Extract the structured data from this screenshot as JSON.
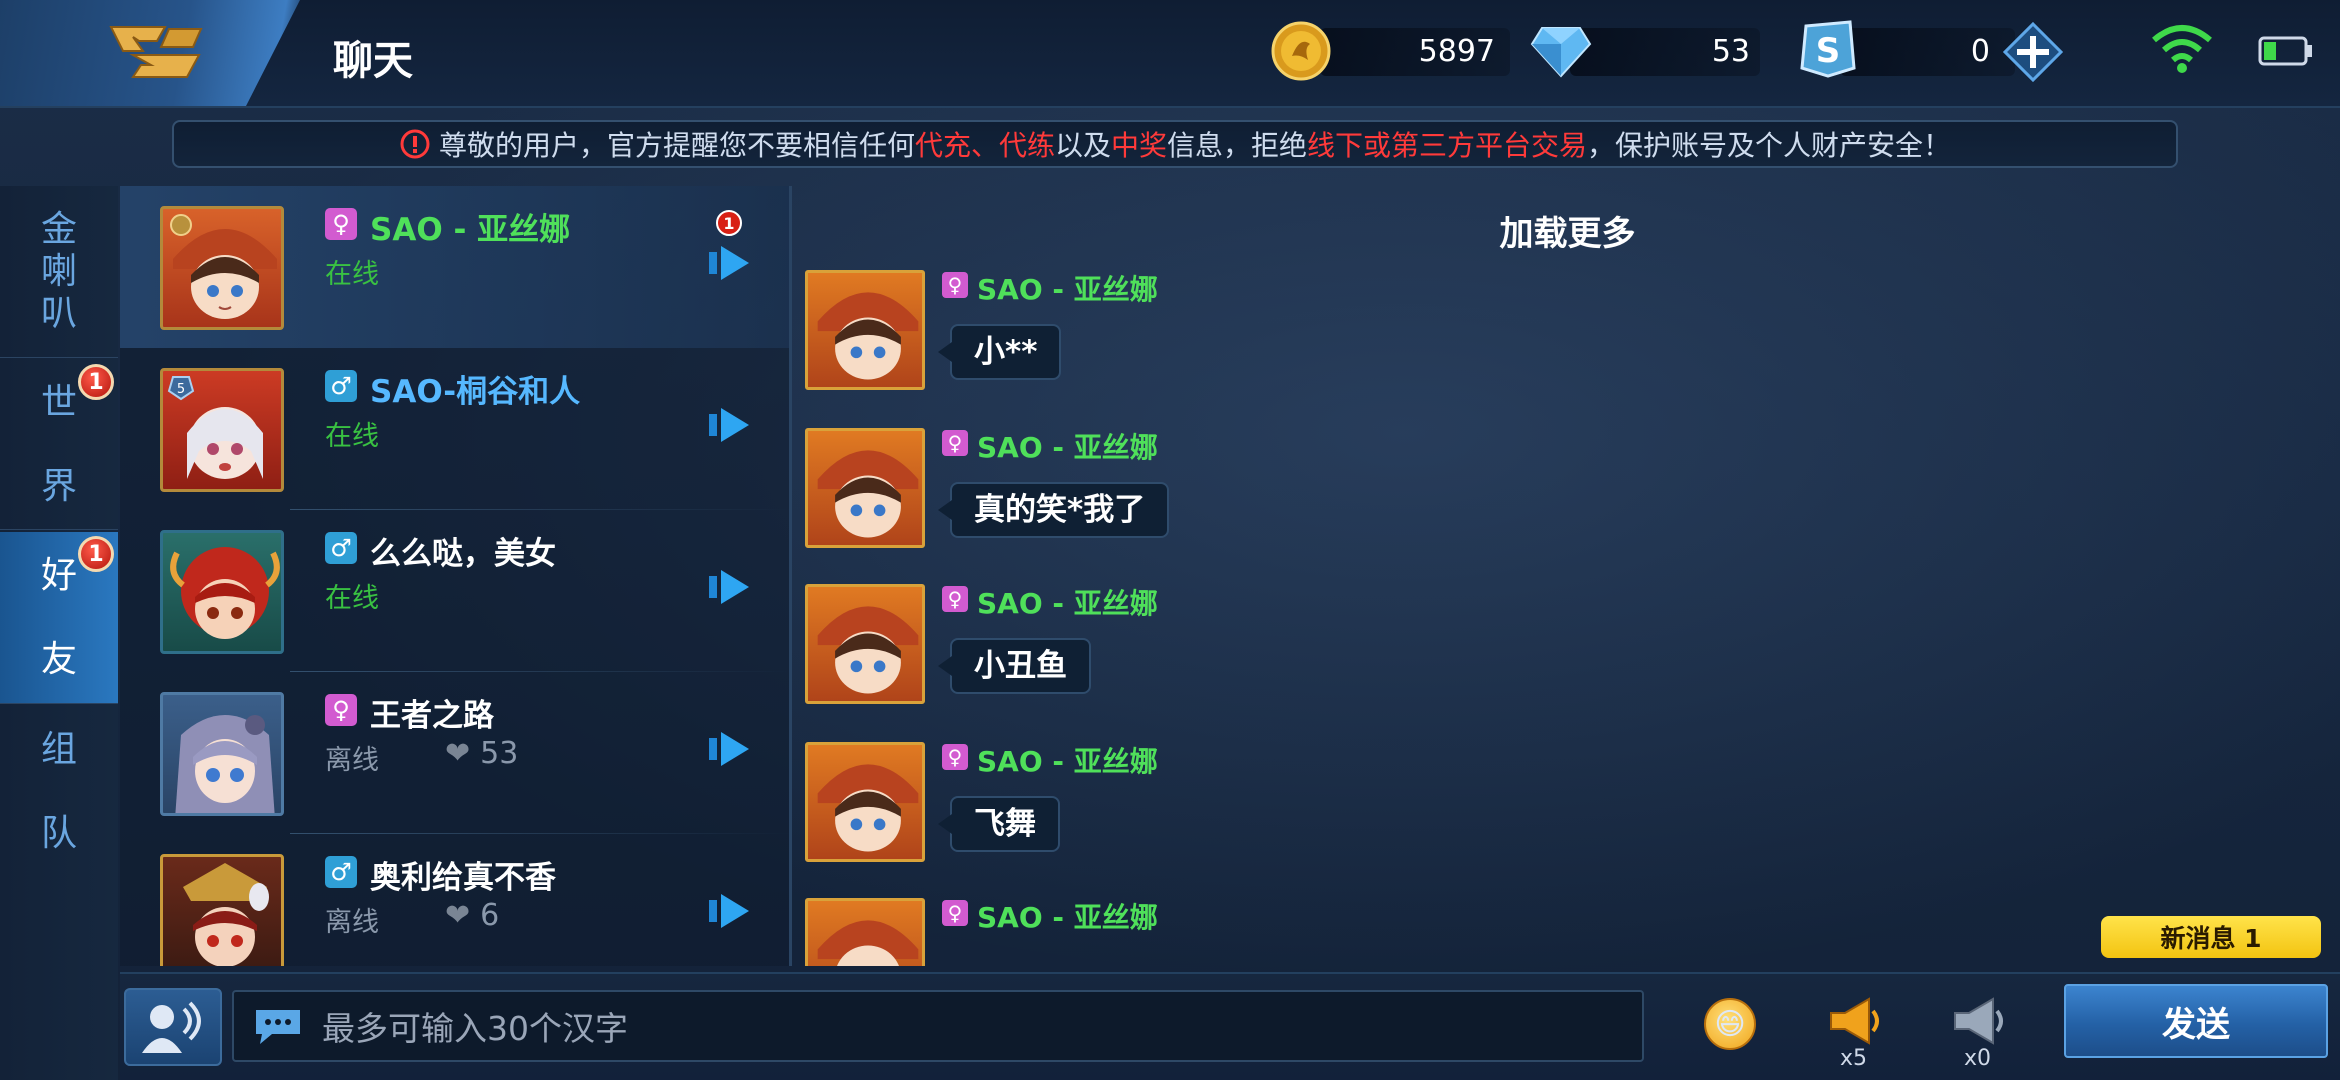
{
  "header": {
    "title": "聊天",
    "gold": "5897",
    "diamonds": "53",
    "tickets": "0"
  },
  "notice": {
    "p1": "尊敬的用户，官方提醒您不要相信任何",
    "r1": "代充、代练",
    "p2": "以及",
    "r2": "中奖",
    "p3": "信息，拒绝",
    "r3": "线下或第三方平台交易",
    "p4": "，保护账号及个人财产安全！"
  },
  "tabs": {
    "gold_horn": [
      "金",
      "喇",
      "叭"
    ],
    "world": [
      "世",
      "界"
    ],
    "friends": [
      "好",
      "友"
    ],
    "team": [
      "组",
      "队"
    ],
    "world_badge": "1",
    "friends_badge": "1"
  },
  "friends": [
    {
      "gender": "♀",
      "name": "SAO - 亚丝娜",
      "status": "在线",
      "unread": "1"
    },
    {
      "gender": "♂",
      "name": "SAO-桐谷和人",
      "status": "在线",
      "level": "5"
    },
    {
      "gender": "♂",
      "name": "么么哒，美女",
      "status": "在线"
    },
    {
      "gender": "♀",
      "name": "王者之路",
      "status": "离线",
      "hearts": "53"
    },
    {
      "gender": "♂",
      "name": "奥利给真不香",
      "status": "离线",
      "hearts": "6"
    }
  ],
  "chat": {
    "load_more": "加载更多",
    "messages": [
      {
        "sender": "SAO - 亚丝娜",
        "gender": "♀",
        "text": "小**"
      },
      {
        "sender": "SAO - 亚丝娜",
        "gender": "♀",
        "text": "真的笑*我了"
      },
      {
        "sender": "SAO - 亚丝娜",
        "gender": "♀",
        "text": "小丑鱼"
      },
      {
        "sender": "SAO - 亚丝娜",
        "gender": "♀",
        "text": "飞舞"
      },
      {
        "sender": "SAO - 亚丝娜",
        "gender": "♀",
        "text": ""
      }
    ],
    "new_message": "新消息 1"
  },
  "input": {
    "placeholder": "最多可输入30个汉字",
    "horn_big_count": "x5",
    "horn_small_count": "x0",
    "send_label": "发送"
  },
  "colors": {
    "accent_blue": "#2a78c0",
    "online_green": "#39c142",
    "female_pink": "#d25bd0",
    "male_blue": "#2f9fd6",
    "warning_red": "#ff3a3a",
    "new_msg_yellow": "#ffe34a"
  },
  "icons": [
    "back-icon",
    "gold-coin-icon",
    "diamond-icon",
    "ticket-icon",
    "plus-icon",
    "wifi-icon",
    "battery-icon",
    "warning-icon",
    "arrow-right-icon",
    "heart-icon",
    "voice-icon",
    "chat-icon",
    "emoji-icon",
    "horn-icon"
  ]
}
